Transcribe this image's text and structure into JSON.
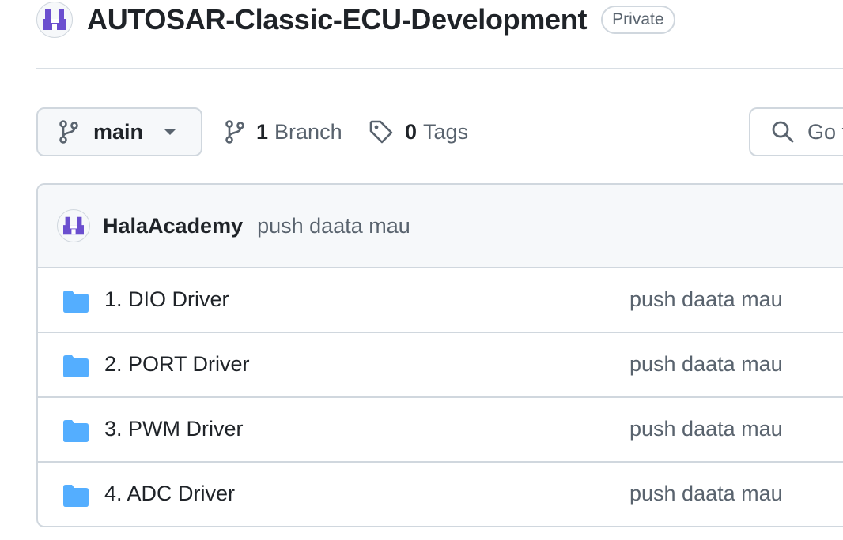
{
  "repo": {
    "name": "AUTOSAR-Classic-ECU-Development",
    "visibility": "Private",
    "avatar_icon": "org-logo-icon",
    "accent_color": "#6b4fcf"
  },
  "toolbar": {
    "branch": "main",
    "branch_count": "1",
    "branch_label": "Branch",
    "tag_count": "0",
    "tag_label": "Tags",
    "search_placeholder": "Go t"
  },
  "latest_commit": {
    "author": "HalaAcademy",
    "message": "push daata mau"
  },
  "files": [
    {
      "name": "1. DIO Driver",
      "type": "folder",
      "message": "push daata mau"
    },
    {
      "name": "2. PORT Driver",
      "type": "folder",
      "message": "push daata mau"
    },
    {
      "name": "3. PWM Driver",
      "type": "folder",
      "message": "push daata mau"
    },
    {
      "name": "4. ADC Driver",
      "type": "folder",
      "message": "push daata mau"
    }
  ],
  "colors": {
    "folder": "#54aeff",
    "border": "#d0d7de",
    "muted_text": "#59636e"
  }
}
